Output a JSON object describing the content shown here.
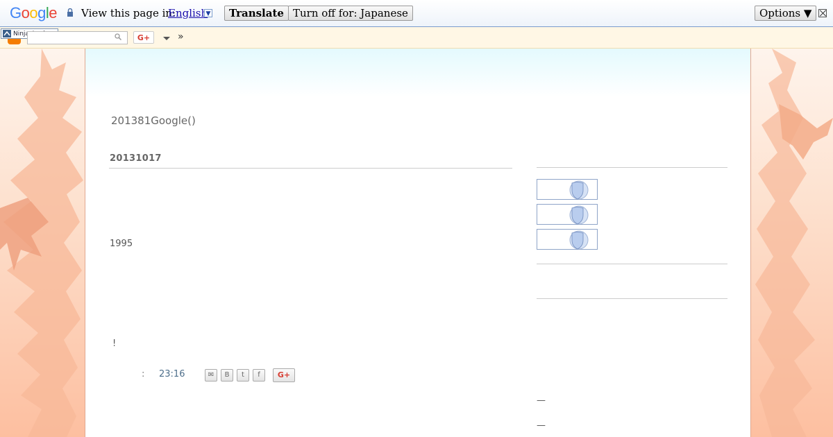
{
  "translate_bar": {
    "logo": "Google",
    "label": "View this page in:",
    "language": "English",
    "dropdown_glyph": "▼",
    "translate_button": "Translate",
    "turn_off_button": "Turn off for: Japanese",
    "options_button": "Options ▼"
  },
  "navbar": {
    "ninja_label": "Ninja Analyze",
    "search_value": "",
    "gplus_label": "G+",
    "more_label": "»"
  },
  "blog": {
    "title": "201381Google()"
  },
  "post": {
    "date_header": "20131017",
    "text1": "1995",
    "text2": "!",
    "footer_colon": ":",
    "time": "23:16",
    "share_gplus": "G+"
  },
  "sidebar": {
    "dash1": "—",
    "dash2": "—"
  },
  "colors": {
    "accent_link": "#1a0dab",
    "gplus_red": "#d73d32",
    "blogger_orange": "#f57d00"
  }
}
